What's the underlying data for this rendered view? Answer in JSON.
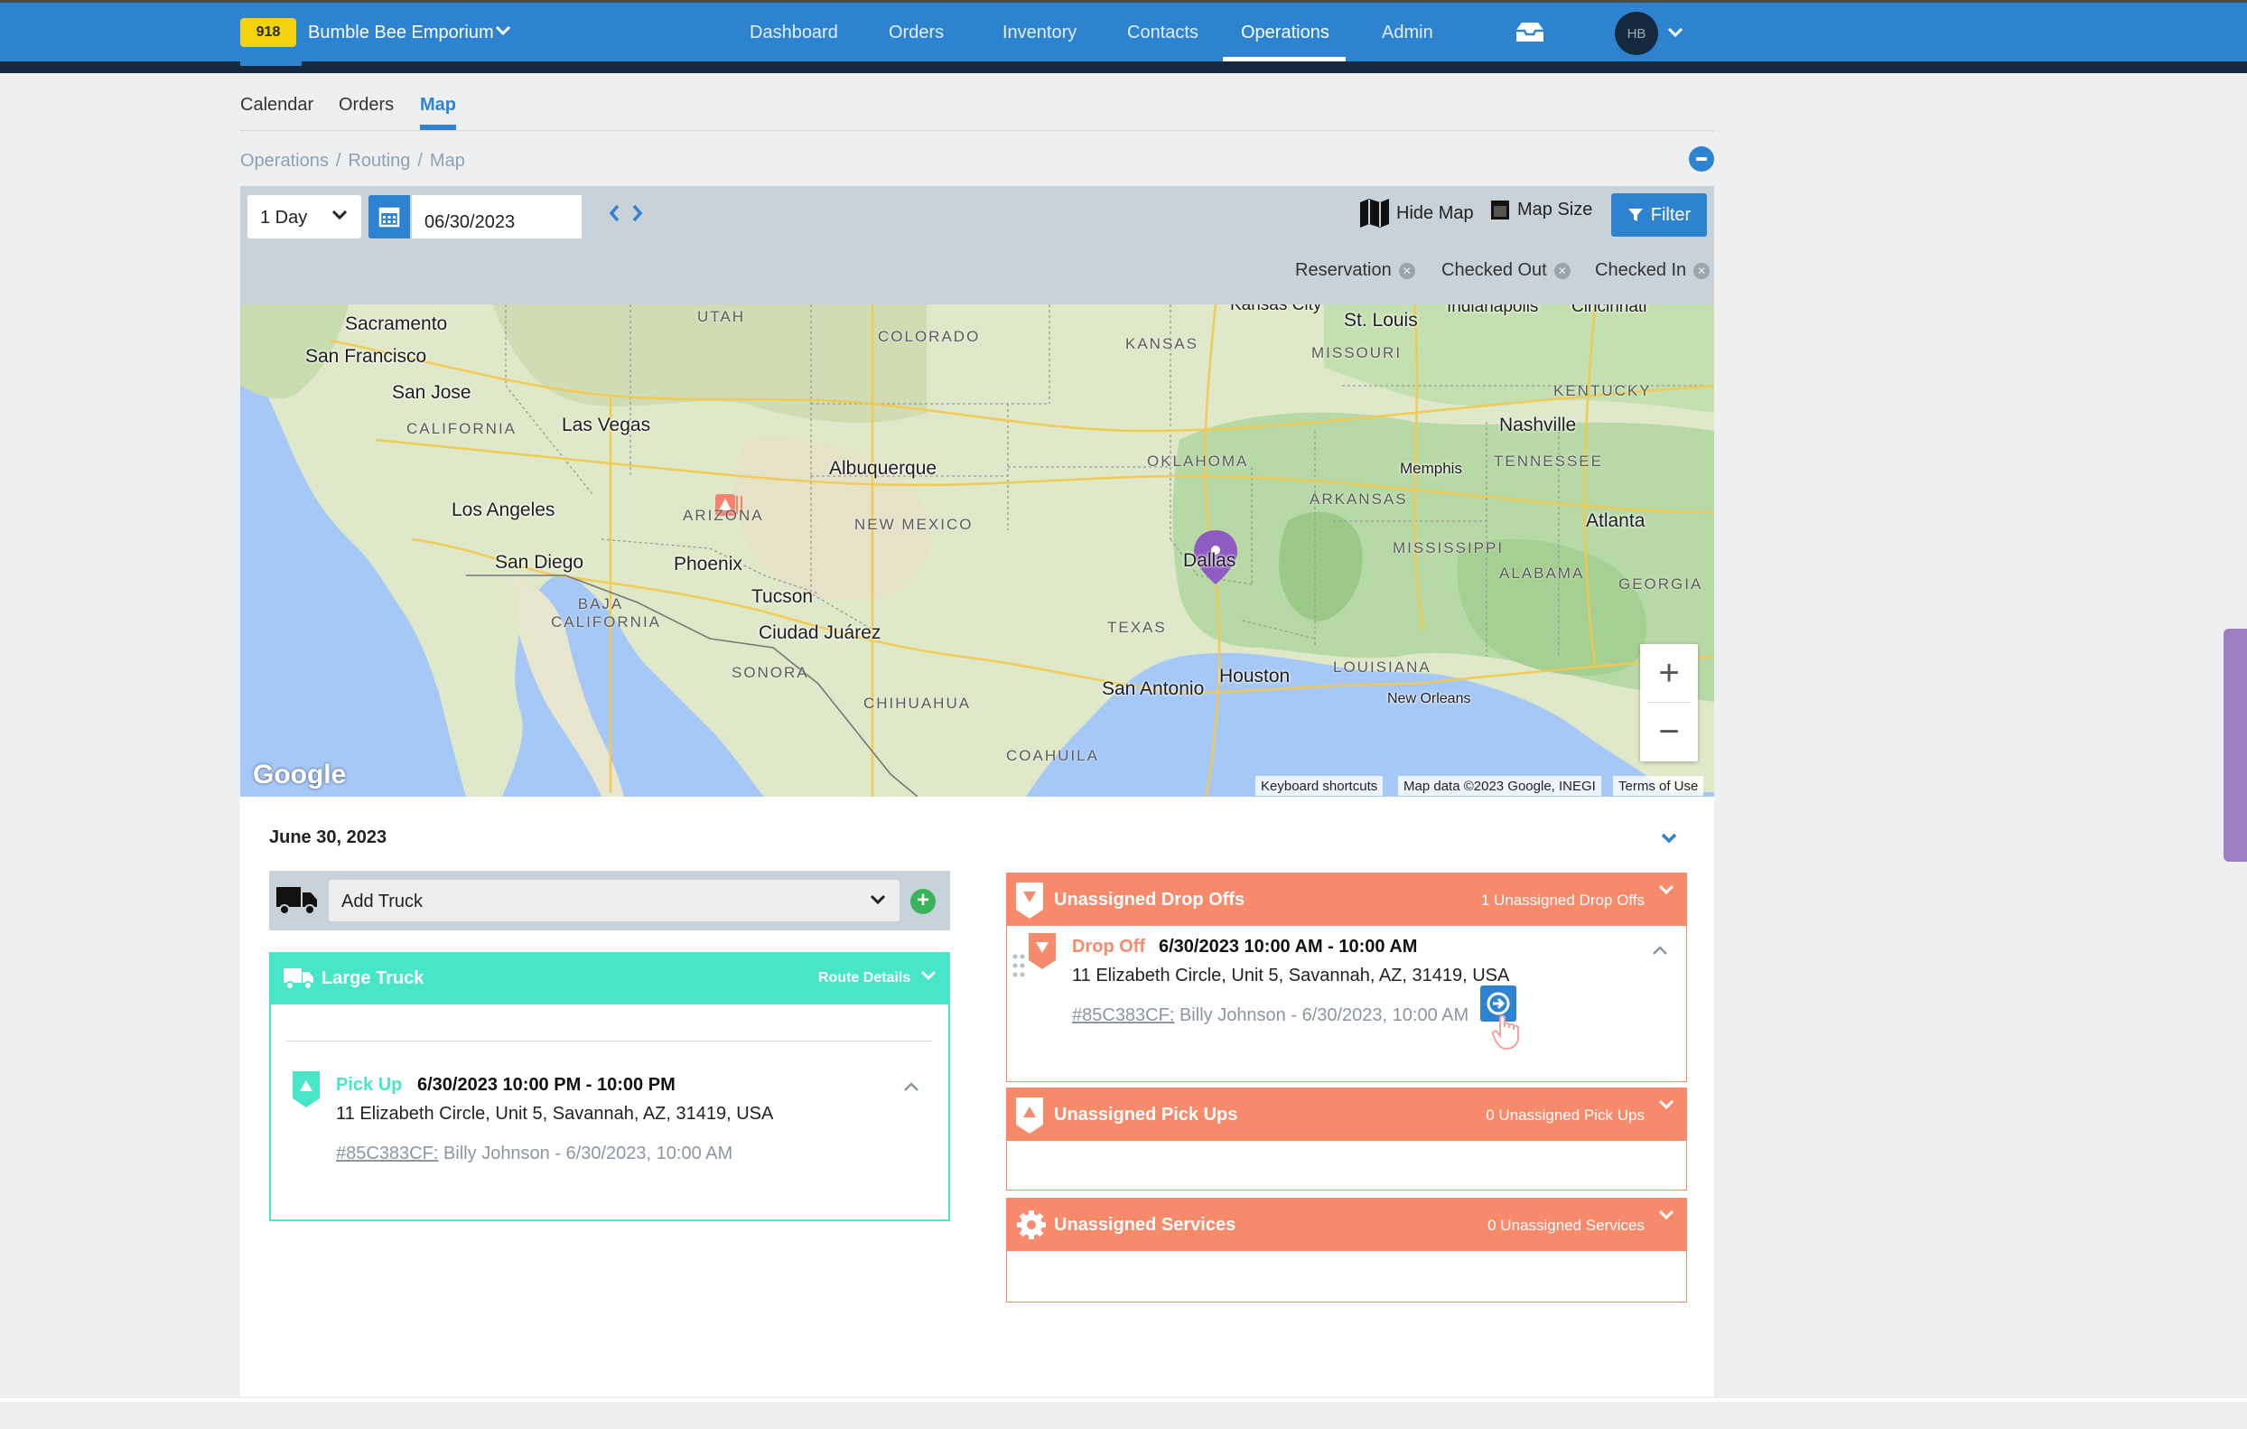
{
  "topnav": {
    "store_badge": "918",
    "store_name": "Bumble Bee Emporium",
    "items": [
      {
        "label": "Dashboard"
      },
      {
        "label": "Orders"
      },
      {
        "label": "Inventory"
      },
      {
        "label": "Contacts"
      },
      {
        "label": "Operations"
      },
      {
        "label": "Admin"
      }
    ],
    "active_item": "Operations",
    "avatar_initials": "HB",
    "icons": [
      "chevron-down-icon",
      "inbox-icon"
    ]
  },
  "subtabs": [
    {
      "label": "Calendar"
    },
    {
      "label": "Orders"
    },
    {
      "label": "Map"
    }
  ],
  "breadcrumb": [
    "Operations",
    "Routing",
    "Map"
  ],
  "toolbar": {
    "range_select": "1 Day",
    "date_value": "06/30/2023",
    "hide_map_label": "Hide Map",
    "map_size_label": "Map Size",
    "filter_label": "Filter",
    "status_chips": [
      "Reservation",
      "Checked Out",
      "Checked In"
    ]
  },
  "map": {
    "cities": [
      "Sacramento",
      "San Francisco",
      "San Jose",
      "Las Vegas",
      "Los Angeles",
      "San Diego",
      "Phoenix",
      "Tucson",
      "Albuquerque",
      "Ciudad Juárez",
      "Dallas",
      "San Antonio",
      "Houston",
      "St. Louis",
      "Nashville",
      "Memphis",
      "Atlanta",
      "New Orleans",
      "Kansas City",
      "Indianapolis",
      "Cincinnati"
    ],
    "states": [
      "UTAH",
      "COLORADO",
      "KANSAS",
      "MISSOURI",
      "KENTUCKY",
      "CALIFORNIA",
      "ARIZONA",
      "NEW MEXICO",
      "OKLAHOMA",
      "ARKANSAS",
      "TENNESSEE",
      "MISSISSIPPI",
      "ALABAMA",
      "GEORGIA",
      "TEXAS",
      "LOUISIANA",
      "BAJA CALIFORNIA",
      "SONORA",
      "CHIHUAHUA",
      "COAHUILA"
    ],
    "google_logo": "Google",
    "attribution": [
      "Keyboard shortcuts",
      "Map data ©2023 Google, INEGI",
      "Terms of Use"
    ],
    "marker_color": "#8e5bc2"
  },
  "panel": {
    "date_heading": "June 30, 2023",
    "add_truck_label": "Add Truck",
    "truck_card": {
      "title": "Large Truck",
      "route_details": "Route Details",
      "stop": {
        "type": "Pick Up",
        "time": "6/30/2023  10:00 PM - 10:00 PM",
        "address": "11 Elizabeth Circle, Unit 5, Savannah, AZ, 31419, USA",
        "order_id": "#85C383CF:",
        "meta": " Billy Johnson - 6/30/2023, 10:00 AM"
      }
    },
    "sections": {
      "drop_offs": {
        "title": "Unassigned Drop Offs",
        "count": "1 Unassigned Drop Offs",
        "stop": {
          "type": "Drop Off",
          "time": "6/30/2023  10:00 AM - 10:00 AM",
          "address": "11 Elizabeth Circle, Unit 5, Savannah, AZ, 31419, USA",
          "order_id": "#85C383CF:",
          "meta": " Billy Johnson - 6/30/2023, 10:00 AM"
        }
      },
      "pick_ups": {
        "title": "Unassigned Pick Ups",
        "count": "0 Unassigned Pick Ups"
      },
      "services": {
        "title": "Unassigned Services",
        "count": "0 Unassigned Services"
      }
    }
  },
  "colors": {
    "primary": "#2d83d0",
    "teal": "#47e6c8",
    "salmon": "#f88a6c",
    "badge": "#f2d30d"
  }
}
